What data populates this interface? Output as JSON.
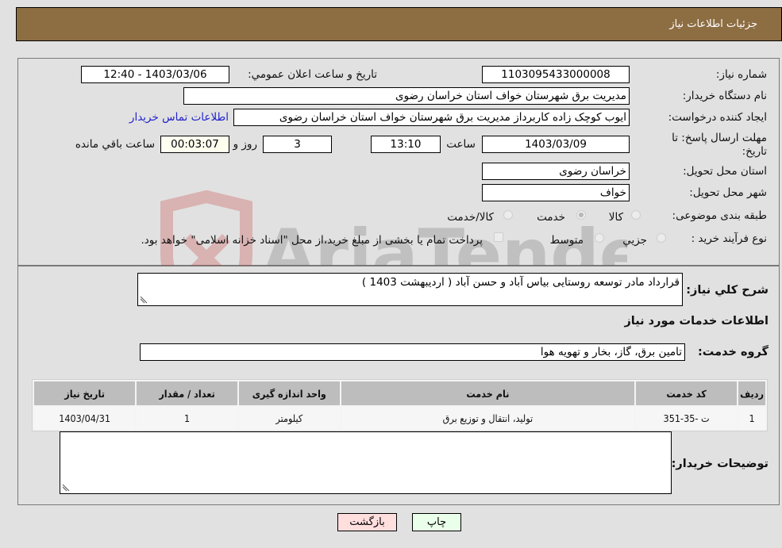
{
  "header": {
    "title": "جزئیات اطلاعات نیاز"
  },
  "form": {
    "need_number": {
      "label": "شماره نیاز:",
      "value": "1103095433000008"
    },
    "announce_datetime": {
      "label": "تاریخ و ساعت اعلان عمومي:",
      "value": "1403/03/06 - 12:40"
    },
    "buyer_org": {
      "label": "نام دستگاه خریدار:",
      "value": "مدیریت برق شهرستان خواف استان خراسان رضوی"
    },
    "requester": {
      "label": "ایجاد کننده درخواست:",
      "value": "ایوب کوچک زاده کاربرداز مدیریت برق شهرستان خواف استان خراسان رضوی"
    },
    "contact_link": "اطلاعات تماس خریدار",
    "deadline": {
      "label_line1": "مهلت ارسال پاسخ: تا",
      "label_line2": "تاریخ:",
      "date": "1403/03/09",
      "time_label": "ساعت",
      "time": "13:10",
      "days": "3",
      "days_label": "روز و",
      "remaining": "00:03:07",
      "remaining_label": "ساعت باقي مانده"
    },
    "province": {
      "label": "استان محل تحویل:",
      "value": "خراسان رضوی"
    },
    "city": {
      "label": "شهر محل تحویل:",
      "value": "خواف"
    },
    "category": {
      "label": "طبقه بندی موضوعی:",
      "options": [
        "کالا",
        "خدمت",
        "کالا/خدمت"
      ],
      "selected": "خدمت"
    },
    "purchase_type": {
      "label": "نوع فرآیند خرید :",
      "options": [
        "جزيي",
        "متوسط"
      ],
      "selected": "متوسط",
      "treasury_checkbox_label": "پرداخت تمام یا بخشی از مبلغ خرید،از محل \"اسناد خزانه اسلامی\" خواهد بود.",
      "treasury_checked": false
    }
  },
  "details": {
    "description_label": "شرح کلي نیاز:",
    "description": "قرارداد مادر توسعه روستایی بیاس آباد و حسن آباد ( اردیبهشت 1403 )",
    "services_heading": "اطلاعات خدمات مورد نیاز",
    "service_group_label": "گروه خدمت:",
    "service_group": "تامین برق، گاز، بخار و تهویه هوا",
    "table": {
      "headers": [
        "ردیف",
        "کد خدمت",
        "نام خدمت",
        "واحد اندازه گیری",
        "تعداد / مقدار",
        "تاریخ نیاز"
      ],
      "rows": [
        [
          "1",
          "ت -35-351",
          "تولید، انتقال و توزیع برق",
          "کیلومتر",
          "1",
          "1403/04/31"
        ]
      ]
    },
    "buyer_notes_label": "توضیحات خریدار:",
    "buyer_notes": ""
  },
  "buttons": {
    "print": "چاپ",
    "back": "بازگشت"
  },
  "watermark": {
    "text": "AriaTender.neT"
  },
  "colors": {
    "header_bg": "#8d6d42",
    "print_bg": "#eaffea",
    "back_bg": "#ffdede",
    "link": "#2222cc"
  }
}
